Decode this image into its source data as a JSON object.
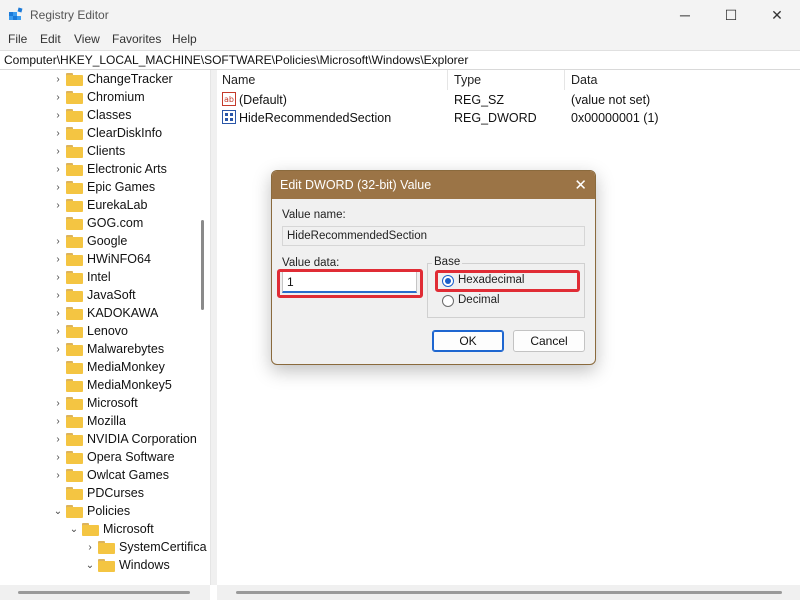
{
  "window": {
    "title": "Registry Editor",
    "minimize_glyph": "─",
    "maximize_glyph": "☐",
    "close_glyph": "✕"
  },
  "menu": [
    "File",
    "Edit",
    "View",
    "Favorites",
    "Help"
  ],
  "address": "Computer\\HKEY_LOCAL_MACHINE\\SOFTWARE\\Policies\\Microsoft\\Windows\\Explorer",
  "tree": {
    "items": [
      "ChangeTracker",
      "Chromium",
      "Classes",
      "ClearDiskInfo",
      "Clients",
      "Electronic Arts",
      "Epic Games",
      "EurekaLab",
      "GOG.com",
      "Google",
      "HWiNFO64",
      "Intel",
      "JavaSoft",
      "KADOKAWA",
      "Lenovo",
      "Malwarebytes",
      "MediaMonkey",
      "MediaMonkey5",
      "Microsoft",
      "Mozilla",
      "NVIDIA Corporation",
      "Opera Software",
      "Owlcat Games",
      "PDCurses",
      "Policies"
    ],
    "policies_children": [
      "Microsoft"
    ],
    "microsoft_children": [
      "SystemCertifica",
      "Windows"
    ]
  },
  "list": {
    "columns": [
      "Name",
      "Type",
      "Data"
    ],
    "rows": [
      {
        "name": "(Default)",
        "type": "REG_SZ",
        "data": "(value not set)",
        "icon": "string-value-icon"
      },
      {
        "name": "HideRecommendedSection",
        "type": "REG_DWORD",
        "data": "0x00000001 (1)",
        "icon": "dword-value-icon"
      }
    ]
  },
  "dialog": {
    "title": "Edit DWORD (32-bit) Value",
    "value_name_label": "Value name:",
    "value_name": "HideRecommendedSection",
    "value_data_label": "Value data:",
    "value_data": "1",
    "base_label": "Base",
    "hex_label": "Hexadecimal",
    "dec_label": "Decimal",
    "hex_selected": true,
    "ok": "OK",
    "cancel": "Cancel"
  },
  "colors": {
    "dialog_title": "#9b7446",
    "highlight": "#e02c35",
    "folder": "#f4c542"
  }
}
